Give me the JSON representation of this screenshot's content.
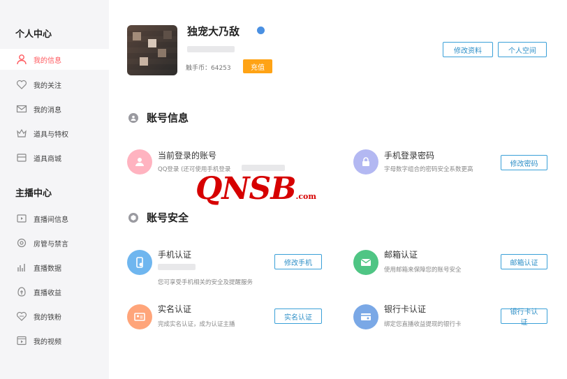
{
  "sidebar": {
    "personal_title": "个人中心",
    "personal_items": [
      {
        "label": "我的信息",
        "icon": "user-icon"
      },
      {
        "label": "我的关注",
        "icon": "heart-icon"
      },
      {
        "label": "我的消息",
        "icon": "mail-icon"
      },
      {
        "label": "道具与特权",
        "icon": "crown-icon"
      },
      {
        "label": "道具商城",
        "icon": "store-icon"
      }
    ],
    "anchor_title": "主播中心",
    "anchor_items": [
      {
        "label": "直播间信息",
        "icon": "tv-icon"
      },
      {
        "label": "房管与禁言",
        "icon": "gear-icon"
      },
      {
        "label": "直播数据",
        "icon": "bar-chart-icon"
      },
      {
        "label": "直播收益",
        "icon": "money-icon"
      },
      {
        "label": "我的铁粉",
        "icon": "heart-outline-icon"
      },
      {
        "label": "我的视频",
        "icon": "video-icon"
      }
    ]
  },
  "profile": {
    "username": "独宠大乃敌",
    "coins_label": "触手币：64253",
    "charge_label": "充值",
    "edit_profile_label": "修改资料",
    "personal_space_label": "个人空间"
  },
  "account_info": {
    "title": "账号信息",
    "current_account_title": "当前登录的账号",
    "current_account_desc": "QQ登录 (还可使用手机登录",
    "phone_password_title": "手机登录密码",
    "phone_password_desc": "字母数字组合的密码安全系数更高",
    "change_password_label": "修改密码"
  },
  "account_security": {
    "title": "账号安全",
    "phone_title": "手机认证",
    "phone_desc": "您可享受手机相关的安全及提醒服务",
    "phone_button": "修改手机",
    "email_title": "邮箱认证",
    "email_desc": "使用邮箱来保障您的账号安全",
    "email_button": "邮箱认证",
    "realname_title": "实名认证",
    "realname_desc": "完成实名认证，成为认证主播",
    "realname_button": "实名认证",
    "bank_title": "银行卡认证",
    "bank_desc": "绑定您直播收益提现的银行卡",
    "bank_button": "银行卡认证"
  },
  "watermark": {
    "text": "QNSB",
    "suffix": ".com"
  },
  "colors": {
    "accent": "#ff5a5f",
    "blue": "#3aa0d8",
    "orange": "#ffa315",
    "red_watermark": "#d60000"
  }
}
